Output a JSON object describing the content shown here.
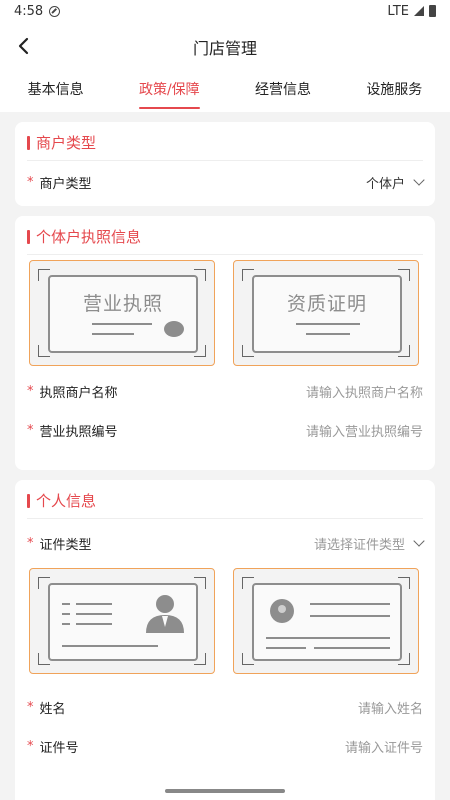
{
  "status": {
    "time": "4:58",
    "network": "LTE"
  },
  "header": {
    "title": "门店管理"
  },
  "tabs": [
    {
      "label": "基本信息"
    },
    {
      "label": "政策/保障",
      "active": true
    },
    {
      "label": "经营信息"
    },
    {
      "label": "设施服务"
    }
  ],
  "merchant_type": {
    "title": "商户类型",
    "row": {
      "label": "商户类型",
      "value": "个体户"
    }
  },
  "license": {
    "title": "个体户执照信息",
    "upload_license_text": "营业执照",
    "upload_qualification_text": "资质证明",
    "merchant_name": {
      "label": "执照商户名称",
      "placeholder": "请输入执照商户名称"
    },
    "license_number": {
      "label": "营业执照编号",
      "placeholder": "请输入营业执照编号"
    }
  },
  "personal": {
    "title": "个人信息",
    "id_type": {
      "label": "证件类型",
      "placeholder": "请选择证件类型"
    },
    "name": {
      "label": "姓名",
      "placeholder": "请输入姓名"
    },
    "id_number": {
      "label": "证件号",
      "placeholder": "请输入证件号"
    }
  },
  "required_mark": "*",
  "colors": {
    "accent": "#e5484d",
    "upload_border": "#f0a35a"
  }
}
